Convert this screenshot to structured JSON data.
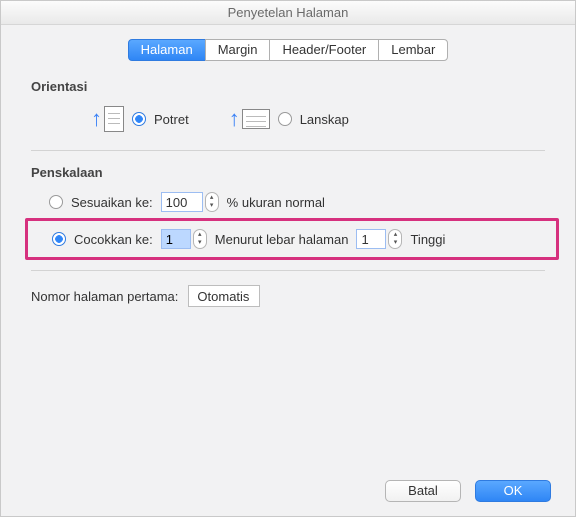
{
  "window": {
    "title": "Penyetelan Halaman"
  },
  "tabs": {
    "page": "Halaman",
    "margin": "Margin",
    "headerfooter": "Header/Footer",
    "sheet": "Lembar"
  },
  "orientation": {
    "heading": "Orientasi",
    "portrait": "Potret",
    "landscape": "Lanskap",
    "selected": "portrait"
  },
  "scaling": {
    "heading": "Penskalaan",
    "adjust_label": "Sesuaikan ke:",
    "adjust_value": "100",
    "adjust_suffix": "% ukuran normal",
    "fit_label": "Cocokkan ke:",
    "fit_wide_value": "1",
    "fit_wide_suffix": "Menurut lebar halaman",
    "fit_tall_value": "1",
    "fit_tall_suffix": "Tinggi",
    "selected": "fit"
  },
  "first_page": {
    "label": "Nomor halaman pertama:",
    "value": "Otomatis"
  },
  "buttons": {
    "cancel": "Batal",
    "ok": "OK"
  }
}
